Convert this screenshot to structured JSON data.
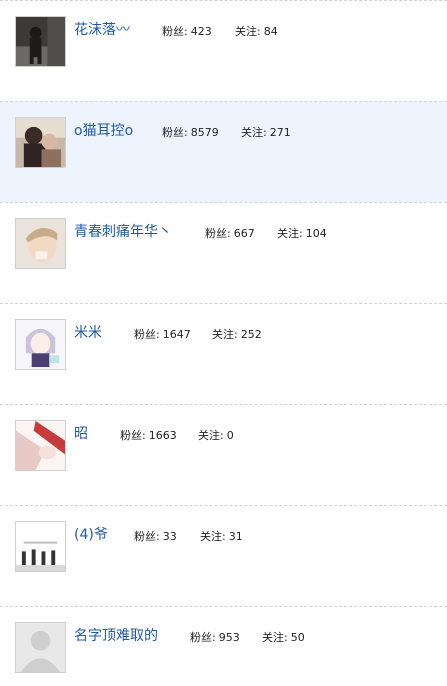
{
  "fans_label": "粉丝:",
  "follow_label": "关注:",
  "users": [
    {
      "name": "花沫落〰",
      "fans": "423",
      "follow": "84"
    },
    {
      "name": "o猫耳控o",
      "fans": "8579",
      "follow": "271"
    },
    {
      "name": "青春刺痛年华丶",
      "fans": "667",
      "follow": "104"
    },
    {
      "name": "米米",
      "fans": "1647",
      "follow": "252"
    },
    {
      "name": "昭",
      "fans": "1663",
      "follow": "0"
    },
    {
      "name": "(4)爷",
      "fans": "33",
      "follow": "31"
    },
    {
      "name": "名字顶难取的",
      "fans": "953",
      "follow": "50"
    }
  ],
  "colors": {
    "name_link": "#1e5aa8",
    "highlight_row": "#eef4fe",
    "divider": "#d2d2d2"
  }
}
